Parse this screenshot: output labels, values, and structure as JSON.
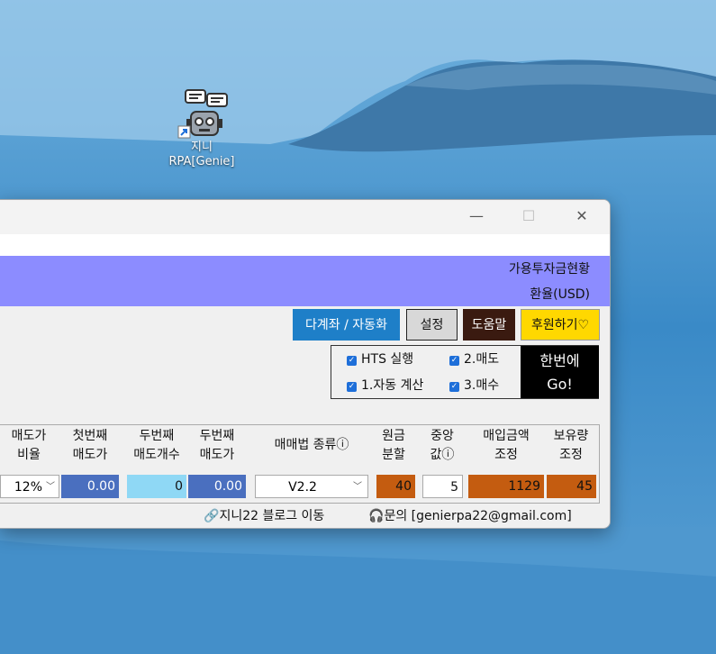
{
  "desktop": {
    "icon_label_line1": "지니",
    "icon_label_line2": "RPA[Genie]"
  },
  "window": {
    "minimize": "—",
    "maximize": "☐",
    "close": "✕"
  },
  "info": {
    "available_funds": "가용투자금현황",
    "exchange_rate": "환율(USD)"
  },
  "buttons": {
    "multi_account": "다계좌 / 자동화",
    "settings": "설정",
    "help": "도움말",
    "donate": "후원하기♡"
  },
  "options": {
    "hts_run": "HTS 실행",
    "sell": "2.매도",
    "auto_calc": "1.자동 계산",
    "buy": "3.매수",
    "go_line1": "한번에",
    "go_line2": "Go!"
  },
  "table": {
    "headers": [
      [
        "매도가",
        "비율"
      ],
      [
        "첫번째",
        "매도가"
      ],
      [
        "두번째",
        "매도개수"
      ],
      [
        "두번째",
        "매도가"
      ],
      [
        "매매법 종류ⓘ",
        ""
      ],
      [
        "원금",
        "분할"
      ],
      [
        "중앙",
        "값ⓘ"
      ],
      [
        "매입금액",
        "조정"
      ],
      [
        "보유량",
        "조정"
      ]
    ],
    "values": {
      "sell_ratio": "12%",
      "first_sell_price": "0.00",
      "second_sell_count": "0",
      "second_sell_price": "0.00",
      "method": "V2.2",
      "principal_split": "40",
      "median": "5",
      "purchase_adjust": "1129",
      "holding_adjust": "45"
    }
  },
  "footer": {
    "blog_link": "지니22 블로그 이동",
    "contact": "문의 [genierpa22@gmail.com]"
  },
  "colors": {
    "purple_bar": "#8c8cff",
    "multi_account_btn": "#1e7fc8",
    "help_btn": "#3a1a10",
    "donate_btn": "#ffd800",
    "cell_blue": "#4a6fbf",
    "cell_light_blue": "#8fd8f5",
    "cell_orange": "#c45c10"
  }
}
